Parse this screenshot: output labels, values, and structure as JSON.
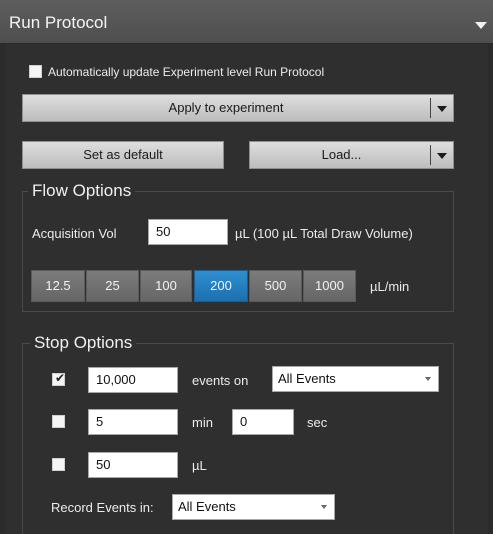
{
  "panel": {
    "title": "Run Protocol"
  },
  "auto_update": {
    "label": "Automatically update Experiment level Run Protocol",
    "checked": false
  },
  "buttons": {
    "apply": "Apply to experiment",
    "set_default": "Set as default",
    "load": "Load..."
  },
  "flow_options": {
    "title": "Flow Options",
    "acquisition_label": "Acquisition Vol",
    "acquisition_value": "50",
    "acquisition_unit": "µL (100 µL Total Draw Volume)",
    "rates": [
      "12.5",
      "25",
      "100",
      "200",
      "500",
      "1000"
    ],
    "selected_rate": "200",
    "rate_unit": "µL/min"
  },
  "stop_options": {
    "title": "Stop Options",
    "events": {
      "checked": true,
      "value": "10,000",
      "label": "events on",
      "select": "All Events"
    },
    "time": {
      "checked": false,
      "min_value": "5",
      "min_label": "min",
      "sec_value": "0",
      "sec_label": "sec"
    },
    "volume": {
      "checked": false,
      "value": "50",
      "unit": "µL"
    },
    "record_label": "Record Events in:",
    "record_select": "All Events"
  },
  "colors": {
    "accent": "#2b86c8",
    "panel_bg": "#2f2f2f"
  },
  "icons": {
    "collapse": "triangle-down-icon",
    "check": "checkmark-icon",
    "dropdown": "caret-down-icon"
  }
}
